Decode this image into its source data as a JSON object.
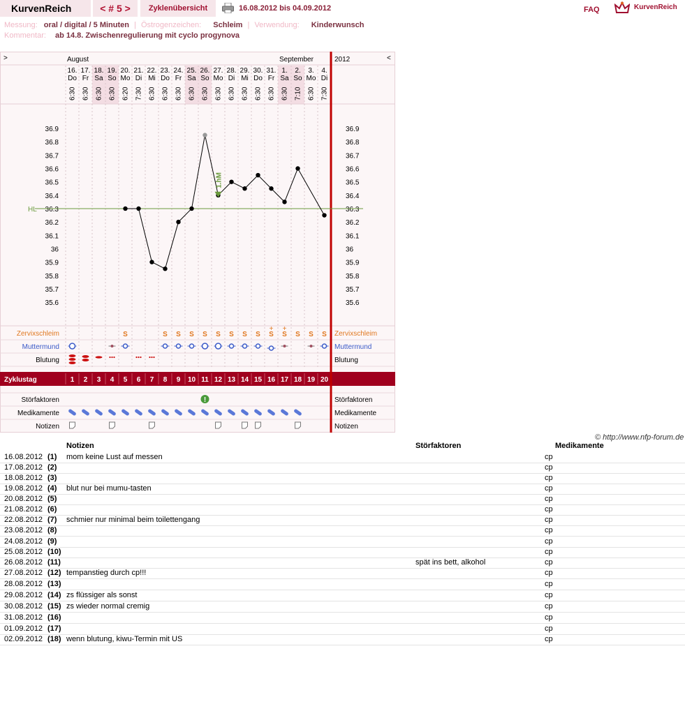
{
  "header": {
    "brand": "KurvenReich",
    "cycle_nav": "< # 5 >",
    "overview": "Zyklenübersicht",
    "date_range": "16.08.2012 bis 04.09.2012",
    "faq": "FAQ",
    "logo_text": "KurvenReich"
  },
  "meta": {
    "messung_label": "Messung:",
    "messung_value": "oral / digital / 5 Minuten",
    "oestrogen_label": "Östrogenzeichen:",
    "oestrogen_value": "Schleim",
    "verwendung_label": "Verwendung:",
    "verwendung_value": "Kinderwunsch",
    "kommentar_label": "Kommentar:",
    "kommentar_value": "ab 14.8. Zwischenregulierung mit cyclo progynova"
  },
  "chart_data": {
    "type": "line",
    "month_left": "August",
    "month_right": "September",
    "year": "2012",
    "nav_left": ">",
    "nav_right": "<",
    "days": [
      {
        "d": "16.",
        "w": "Do",
        "t": "6:30",
        "we": false
      },
      {
        "d": "17.",
        "w": "Fr",
        "t": "6:30",
        "we": false
      },
      {
        "d": "18.",
        "w": "Sa",
        "t": "6:30",
        "we": true
      },
      {
        "d": "19.",
        "w": "So",
        "t": "6:30",
        "we": true
      },
      {
        "d": "20.",
        "w": "Mo",
        "t": "6:20",
        "we": false
      },
      {
        "d": "21.",
        "w": "Di",
        "t": "7:30",
        "we": false
      },
      {
        "d": "22.",
        "w": "Mi",
        "t": "6:30",
        "we": false
      },
      {
        "d": "23.",
        "w": "Do",
        "t": "6:30",
        "we": false
      },
      {
        "d": "24.",
        "w": "Fr",
        "t": "6:30",
        "we": false
      },
      {
        "d": "25.",
        "w": "Sa",
        "t": "6:30",
        "we": true
      },
      {
        "d": "26.",
        "w": "So",
        "t": "6:30",
        "we": true
      },
      {
        "d": "27.",
        "w": "Mo",
        "t": "6:30",
        "we": false
      },
      {
        "d": "28.",
        "w": "Di",
        "t": "6:30",
        "we": false
      },
      {
        "d": "29.",
        "w": "Mi",
        "t": "6:30",
        "we": false
      },
      {
        "d": "30.",
        "w": "Do",
        "t": "6:30",
        "we": false
      },
      {
        "d": "31.",
        "w": "Fr",
        "t": "6:30",
        "we": false
      },
      {
        "d": "1.",
        "w": "Sa",
        "t": "6:30",
        "we": true
      },
      {
        "d": "2.",
        "w": "So",
        "t": "7:10",
        "we": true
      },
      {
        "d": "3.",
        "w": "Mo",
        "t": "6:30",
        "we": false
      },
      {
        "d": "4.",
        "w": "Di",
        "t": "7:30",
        "we": false
      }
    ],
    "temps": [
      null,
      null,
      null,
      null,
      36.3,
      36.3,
      35.9,
      35.85,
      36.2,
      36.3,
      36.85,
      36.4,
      36.5,
      36.45,
      36.55,
      36.45,
      36.35,
      36.6,
      null,
      36.25
    ],
    "excluded_index": 10,
    "y_ticks": [
      "36.9",
      "36.8",
      "36.7",
      "36.6",
      "36.5",
      "36.4",
      "36.3",
      "36.2",
      "36.1",
      "36",
      "35.9",
      "35.8",
      "35.7",
      "35.6"
    ],
    "ylim": [
      35.6,
      36.9
    ],
    "hl_value": 36.3,
    "hl_label": "HL",
    "annotation": "1.hM",
    "annotation_index": 11,
    "rows": {
      "zervix_label": "Zervixschleim",
      "zervix": [
        "",
        "",
        "",
        "",
        "S",
        "",
        "",
        "S",
        "S",
        "S",
        "S",
        "S",
        "S",
        "S",
        "S",
        "S+",
        "S+",
        "S",
        "S",
        "S"
      ],
      "mumu_label": "Muttermund",
      "mumu": [
        "cw",
        "",
        "",
        "dot",
        "o",
        "",
        "",
        "o",
        "o",
        "o",
        "ow",
        "ow",
        "o",
        "o",
        "o",
        "low",
        "dot",
        "",
        "dot",
        "o"
      ],
      "blutung_label": "Blutung",
      "blutung": [
        3,
        2,
        1,
        0.5,
        0,
        0.5,
        0.5,
        0,
        0,
        0,
        0,
        0,
        0,
        0,
        0,
        0,
        0,
        0,
        0,
        0
      ],
      "zyklustag_label": "Zyklustag",
      "zyklustag": [
        "1",
        "2",
        "3",
        "4",
        "5",
        "6",
        "7",
        "8",
        "9",
        "10",
        "11",
        "12",
        "13",
        "14",
        "15",
        "16",
        "17",
        "18",
        "19",
        "20"
      ],
      "stoer_label": "Störfaktoren",
      "stoer": [
        false,
        false,
        false,
        false,
        false,
        false,
        false,
        false,
        false,
        false,
        true,
        false,
        false,
        false,
        false,
        false,
        false,
        false,
        false,
        false
      ],
      "stoer_icon": "exclamation-icon",
      "medi_label": "Medikamente",
      "medi": [
        true,
        true,
        true,
        true,
        true,
        true,
        true,
        true,
        true,
        true,
        true,
        true,
        true,
        true,
        true,
        true,
        true,
        true,
        false,
        false
      ],
      "medi_icon": "pill-icon",
      "notiz_label": "Notizen",
      "notiz": [
        true,
        false,
        false,
        true,
        false,
        false,
        true,
        false,
        false,
        false,
        false,
        true,
        false,
        true,
        true,
        false,
        false,
        true,
        false,
        false
      ],
      "notiz_icon": "note-icon"
    },
    "colors": {
      "accent": "#a0001e",
      "weekend": "#f3dde3",
      "line": "#000000",
      "hl": "#6a9a3c",
      "zervix": "#e07820",
      "mumu": "#3a5ac8",
      "blood": "#cc1010"
    }
  },
  "copyright": "© http://www.nfp-forum.de",
  "notes_table": {
    "headers": {
      "notes": "Notizen",
      "stoer": "Störfaktoren",
      "medi": "Medikamente"
    },
    "rows": [
      {
        "date": "16.08.2012",
        "num": "(1)",
        "note": "mom keine Lust auf messen",
        "stoer": "",
        "medi": "cp"
      },
      {
        "date": "17.08.2012",
        "num": "(2)",
        "note": "",
        "stoer": "",
        "medi": "cp"
      },
      {
        "date": "18.08.2012",
        "num": "(3)",
        "note": "",
        "stoer": "",
        "medi": "cp"
      },
      {
        "date": "19.08.2012",
        "num": "(4)",
        "note": "blut nur bei mumu-tasten",
        "stoer": "",
        "medi": "cp"
      },
      {
        "date": "20.08.2012",
        "num": "(5)",
        "note": "",
        "stoer": "",
        "medi": "cp"
      },
      {
        "date": "21.08.2012",
        "num": "(6)",
        "note": "",
        "stoer": "",
        "medi": "cp"
      },
      {
        "date": "22.08.2012",
        "num": "(7)",
        "note": "schmier nur minimal beim toilettengang",
        "stoer": "",
        "medi": "cp"
      },
      {
        "date": "23.08.2012",
        "num": "(8)",
        "note": "",
        "stoer": "",
        "medi": "cp"
      },
      {
        "date": "24.08.2012",
        "num": "(9)",
        "note": "",
        "stoer": "",
        "medi": "cp"
      },
      {
        "date": "25.08.2012",
        "num": "(10)",
        "note": "",
        "stoer": "",
        "medi": "cp"
      },
      {
        "date": "26.08.2012",
        "num": "(11)",
        "note": "",
        "stoer": "spät ins bett, alkohol",
        "medi": "cp"
      },
      {
        "date": "27.08.2012",
        "num": "(12)",
        "note": "tempanstieg durch cp!!!",
        "stoer": "",
        "medi": "cp"
      },
      {
        "date": "28.08.2012",
        "num": "(13)",
        "note": "",
        "stoer": "",
        "medi": "cp"
      },
      {
        "date": "29.08.2012",
        "num": "(14)",
        "note": "zs flüssiger als sonst",
        "stoer": "",
        "medi": "cp"
      },
      {
        "date": "30.08.2012",
        "num": "(15)",
        "note": "zs wieder normal cremig",
        "stoer": "",
        "medi": "cp"
      },
      {
        "date": "31.08.2012",
        "num": "(16)",
        "note": "",
        "stoer": "",
        "medi": "cp"
      },
      {
        "date": "01.09.2012",
        "num": "(17)",
        "note": "",
        "stoer": "",
        "medi": "cp"
      },
      {
        "date": "02.09.2012",
        "num": "(18)",
        "note": "wenn blutung, kiwu-Termin mit US",
        "stoer": "",
        "medi": "cp"
      }
    ]
  }
}
